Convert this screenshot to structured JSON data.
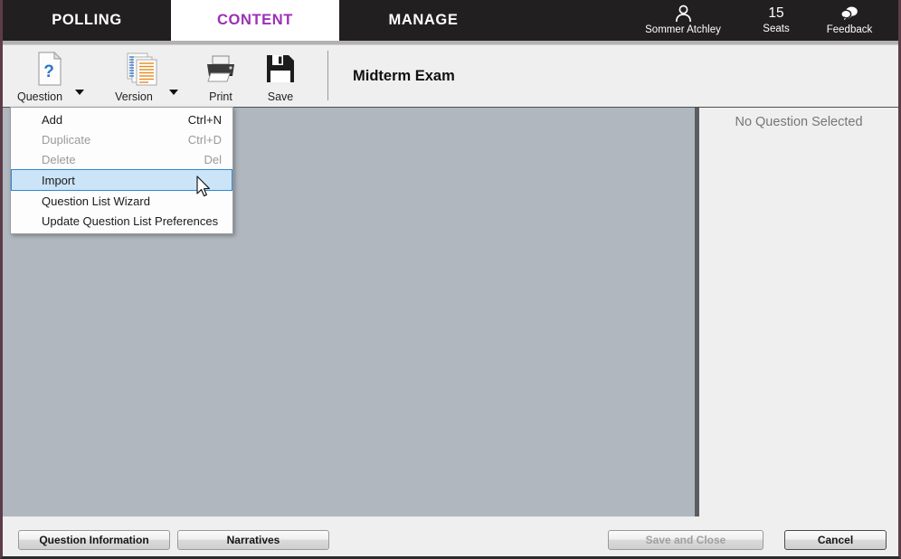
{
  "tabs": [
    {
      "label": "POLLING",
      "active": false
    },
    {
      "label": "CONTENT",
      "active": true
    },
    {
      "label": "MANAGE",
      "active": false
    }
  ],
  "header_right": {
    "user": {
      "icon": "person-icon",
      "label": "Sommer Atchley"
    },
    "seats": {
      "count": "15",
      "label": "Seats"
    },
    "feedback": {
      "icon": "feedback-bubbles-icon",
      "label": "Feedback"
    }
  },
  "toolbar": {
    "question": {
      "label": "Question",
      "icon": "question-document-icon",
      "has_caret": true
    },
    "version": {
      "label": "Version",
      "icon": "version-pages-icon",
      "has_caret": true
    },
    "print": {
      "label": "Print",
      "icon": "printer-icon"
    },
    "save": {
      "label": "Save",
      "icon": "floppy-disk-icon"
    },
    "document_title": "Midterm Exam"
  },
  "menu": {
    "items": [
      {
        "label": "Add",
        "shortcut": "Ctrl+N",
        "disabled": false,
        "highlighted": false
      },
      {
        "label": "Duplicate",
        "shortcut": "Ctrl+D",
        "disabled": true,
        "highlighted": false
      },
      {
        "label": "Delete",
        "shortcut": "Del",
        "disabled": true,
        "highlighted": false
      },
      {
        "label": "Import",
        "shortcut": "",
        "disabled": false,
        "highlighted": true
      },
      {
        "label": "Question List Wizard",
        "shortcut": "",
        "disabled": false,
        "highlighted": false
      },
      {
        "label": "Update Question List Preferences",
        "shortcut": "",
        "disabled": false,
        "highlighted": false
      }
    ]
  },
  "right_panel": {
    "title": "No Question Selected"
  },
  "footer": {
    "question_information": "Question Information",
    "narratives": "Narratives",
    "save_and_close": "Save and Close",
    "cancel": "Cancel"
  },
  "colors": {
    "header_bg": "#221f20",
    "active_tab_text": "#9b30b5",
    "content_bg": "#b0b7bf",
    "panel_bg": "#efefef",
    "menu_highlight_bg": "#cce4f7",
    "menu_highlight_border": "#2f8ad1",
    "window_border": "#5d3c48"
  }
}
